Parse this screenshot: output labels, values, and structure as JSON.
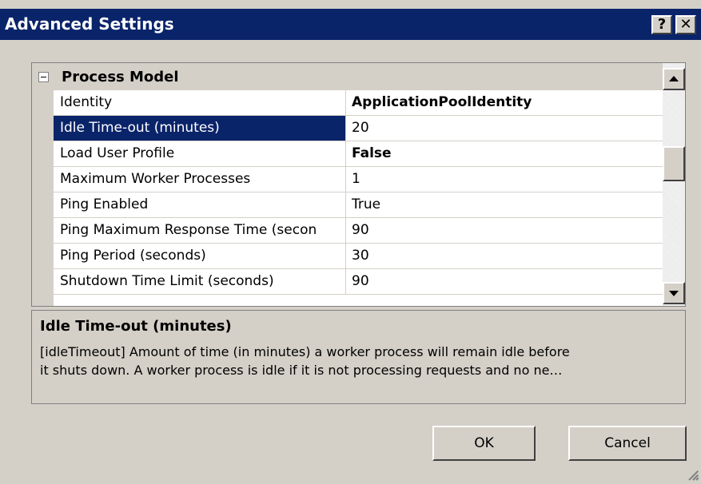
{
  "window": {
    "title": "Advanced Settings",
    "help_glyph": "?",
    "close_glyph": "✕"
  },
  "grid": {
    "category": "Process Model",
    "expander_icon": "minus-box-icon",
    "rows": [
      {
        "name": "Identity",
        "value": "ApplicationPoolIdentity",
        "bold": true,
        "selected": false
      },
      {
        "name": "Idle Time-out (minutes)",
        "value": "20",
        "bold": false,
        "selected": true
      },
      {
        "name": "Load User Profile",
        "value": "False",
        "bold": true,
        "selected": false
      },
      {
        "name": "Maximum Worker Processes",
        "value": "1",
        "bold": false,
        "selected": false
      },
      {
        "name": "Ping Enabled",
        "value": "True",
        "bold": false,
        "selected": false
      },
      {
        "name": "Ping Maximum Response Time (secon",
        "value": "90",
        "bold": false,
        "selected": false
      },
      {
        "name": "Ping Period (seconds)",
        "value": "30",
        "bold": false,
        "selected": false
      },
      {
        "name": "Shutdown Time Limit (seconds)",
        "value": "90",
        "bold": false,
        "selected": false
      }
    ]
  },
  "description": {
    "title": "Idle Time-out (minutes)",
    "line1": "[idleTimeout] Amount of time (in minutes) a worker process will remain idle before",
    "line2": "it shuts down. A worker process is idle if it is not processing requests and no ne…"
  },
  "buttons": {
    "ok": "OK",
    "cancel": "Cancel"
  },
  "colors": {
    "titlebar": "#0a246a",
    "selection": "#0a246a",
    "face": "#d4d0c8"
  }
}
